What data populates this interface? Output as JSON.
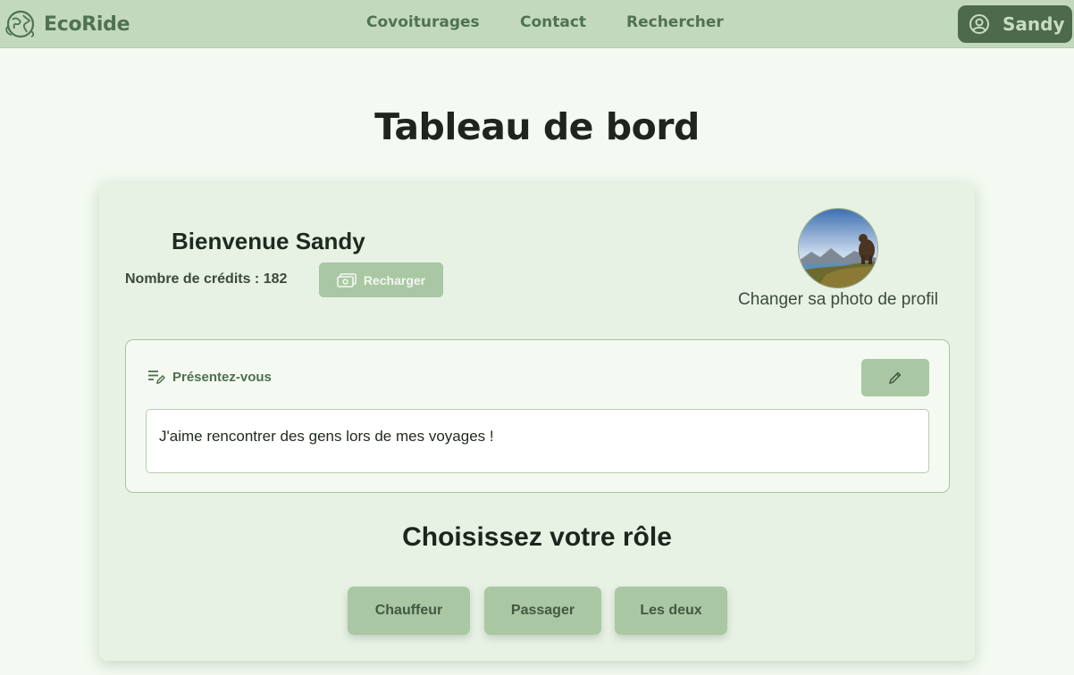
{
  "navbar": {
    "brand": "EcoRide",
    "links": [
      "Covoiturages",
      "Contact",
      "Rechercher"
    ],
    "user": "Sandy"
  },
  "page": {
    "title": "Tableau de bord"
  },
  "profile": {
    "welcome": "Bienvenue Sandy",
    "credits_label": "Nombre de crédits : 182",
    "recharge_label": "Recharger",
    "photo_caption": "Changer sa photo de profil"
  },
  "intro": {
    "label": "Présentez-vous",
    "text": "J'aime rencontrer des gens lors de mes voyages !"
  },
  "role": {
    "title": "Choisissez votre rôle",
    "options": [
      "Chauffeur",
      "Passager",
      "Les deux"
    ]
  },
  "colors": {
    "navbar": "#c3d9be",
    "accent_dark": "#4d6b4c",
    "button": "#a9c7a3",
    "page_bg": "#f3faf1",
    "card_bg": "#e7f1e4"
  },
  "icons": {
    "logo": "globe-leaf-icon",
    "user": "user-circle-icon",
    "recharge": "money-icon",
    "intro": "text-edit-icon",
    "edit": "pencil-icon"
  }
}
